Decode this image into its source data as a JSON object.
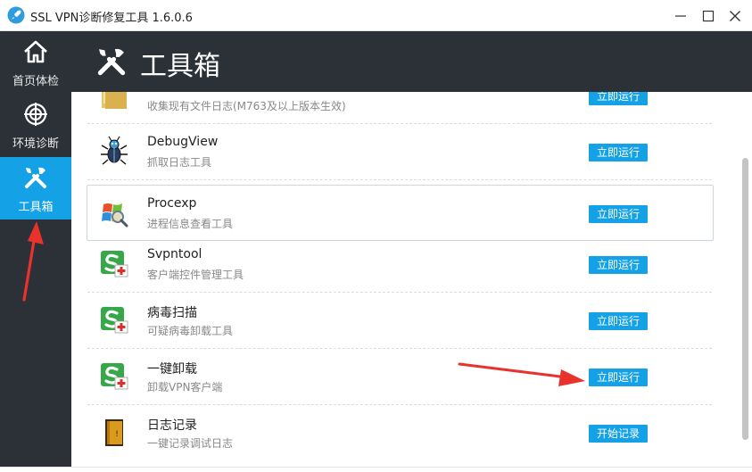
{
  "window": {
    "title": "SSL VPN诊断修复工具 1.6.0.6",
    "buttons": [
      "minimize",
      "maximize",
      "close"
    ]
  },
  "sidebar": {
    "items": [
      {
        "label": "首页体检",
        "icon": "home-icon",
        "active": false
      },
      {
        "label": "环境诊断",
        "icon": "crosshair-icon",
        "active": false
      },
      {
        "label": "工具箱",
        "icon": "tools-icon",
        "active": true
      }
    ]
  },
  "header": {
    "title": "工具箱",
    "icon": "tools-icon"
  },
  "tools": [
    {
      "name": "",
      "desc": "收集现有文件日志(M763及以上版本生效)",
      "button": "立即运行",
      "icon": "folder-icon"
    },
    {
      "name": "DebugView",
      "desc": "抓取日志工具",
      "button": "立即运行",
      "icon": "bug-icon"
    },
    {
      "name": "Procexp",
      "desc": "进程信息查看工具",
      "button": "立即运行",
      "icon": "windows-magnifier-icon"
    },
    {
      "name": "Svpntool",
      "desc": "客户端控件管理工具",
      "button": "立即运行",
      "icon": "sangfor-s-icon"
    },
    {
      "name": "病毒扫描",
      "desc": "可疑病毒卸载工具",
      "button": "立即运行",
      "icon": "sangfor-s-icon"
    },
    {
      "name": "一键卸载",
      "desc": "卸载VPN客户端",
      "button": "立即运行",
      "icon": "sangfor-s-icon"
    },
    {
      "name": "日志记录",
      "desc": "一键记录调试日志",
      "button": "开始记录",
      "icon": "log-book-icon"
    }
  ],
  "colors": {
    "accent": "#15a1e5",
    "sidebar_bg": "#2c3138",
    "annotation_arrow": "#e8322b"
  }
}
